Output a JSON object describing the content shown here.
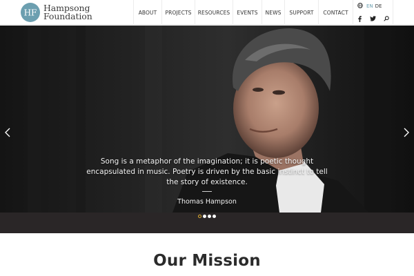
{
  "header": {
    "logo_line1": "Hampsong",
    "logo_line2": "Foundation",
    "logo_monogram": "HF",
    "nav": [
      {
        "label": "ABOUT"
      },
      {
        "label": "PROJECTS"
      },
      {
        "label": "RESOURCES"
      },
      {
        "label": "EVENTS"
      },
      {
        "label": "NEWS"
      },
      {
        "label": "SUPPORT"
      },
      {
        "label": "CONTACT"
      }
    ],
    "lang": {
      "en": "EN",
      "de": "DE",
      "active": "EN"
    },
    "social_icons": [
      "facebook-icon",
      "twitter-icon",
      "search-icon"
    ]
  },
  "hero": {
    "quote": "Song is a metaphor of the imagination; it is poetic thought encapsulated in music. Poetry is driven by the basic instinct to tell the story of existence.",
    "author": "Thomas Hampson",
    "slides": 4,
    "active_slide": 1
  },
  "mission": {
    "title": "Our Mission"
  },
  "colors": {
    "accent": "#6c9fb0",
    "active_dot": "#e3b02f",
    "dots_bar": "#2a2627",
    "heading": "#2b2b2b"
  }
}
